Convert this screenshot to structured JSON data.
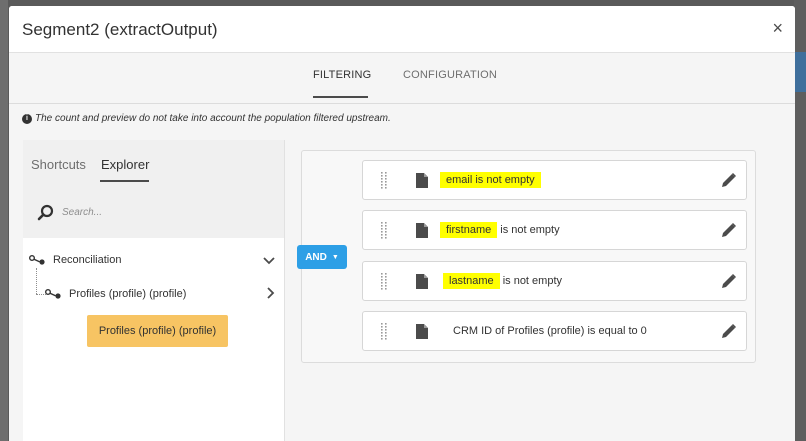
{
  "dialog": {
    "title": "Segment2 (extractOutput)",
    "close_glyph": "×"
  },
  "tabs": [
    {
      "label": "FILTERING",
      "active": true
    },
    {
      "label": "CONFIGURATION",
      "active": false
    }
  ],
  "notice": {
    "text": "The count and preview do not take into account the population filtered upstream.",
    "icon": "info-icon"
  },
  "left_panel": {
    "tabs": [
      {
        "label": "Shortcuts",
        "active": false
      },
      {
        "label": "Explorer",
        "active": true
      }
    ],
    "search": {
      "placeholder": "Search..."
    },
    "tree": [
      {
        "label": "Reconciliation",
        "icon": "link-icon",
        "toggle": "chevron-down-icon"
      },
      {
        "label": "Profiles (profile) (profile)",
        "icon": "link-icon",
        "toggle": "chevron-right-icon"
      }
    ],
    "tooltip": "Profiles (profile) (profile)"
  },
  "operator": {
    "label": "AND",
    "caret": "▼"
  },
  "rules": [
    {
      "highlight": "email is not empty",
      "text": "",
      "highlight_color": "#ffff00"
    },
    {
      "highlight": "firstname",
      "text": " is not empty",
      "highlight_color": "#ffff00"
    },
    {
      "highlight": "lastname",
      "text": " is not empty",
      "highlight_color": "#ffff00"
    },
    {
      "highlight": "",
      "text": "CRM ID of Profiles (profile) is equal to 0"
    }
  ],
  "colors": {
    "accent": "#2d9fe6",
    "tooltip_bg": "#f7c463",
    "highlight": "#ffff00"
  }
}
